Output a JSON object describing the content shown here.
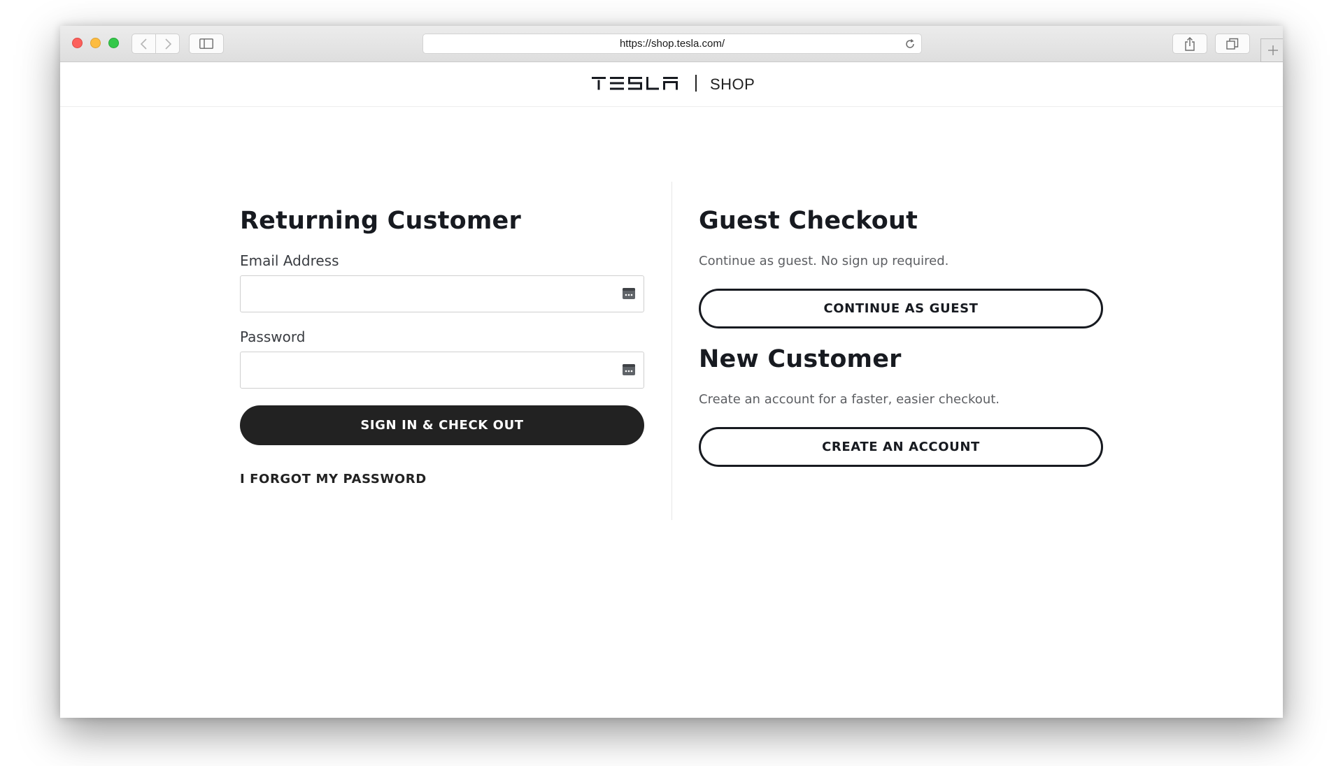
{
  "browser": {
    "url": "https://shop.tesla.com/"
  },
  "header": {
    "logo_alt": "TESLA",
    "shop_label": "SHOP"
  },
  "returning": {
    "title": "Returning Customer",
    "email_label": "Email Address",
    "email_value": "",
    "password_label": "Password",
    "password_value": "",
    "sign_in_button": "SIGN IN & CHECK OUT",
    "forgot_link": "I FORGOT MY PASSWORD"
  },
  "guest": {
    "title": "Guest Checkout",
    "description": "Continue as guest. No sign up required.",
    "button": "CONTINUE AS GUEST"
  },
  "new_customer": {
    "title": "New Customer",
    "description": "Create an account for a faster, easier checkout.",
    "button": "CREATE AN ACCOUNT"
  },
  "colors": {
    "primary_button": "#222222",
    "heading_text": "#171a20",
    "body_text": "#5c5e62"
  }
}
